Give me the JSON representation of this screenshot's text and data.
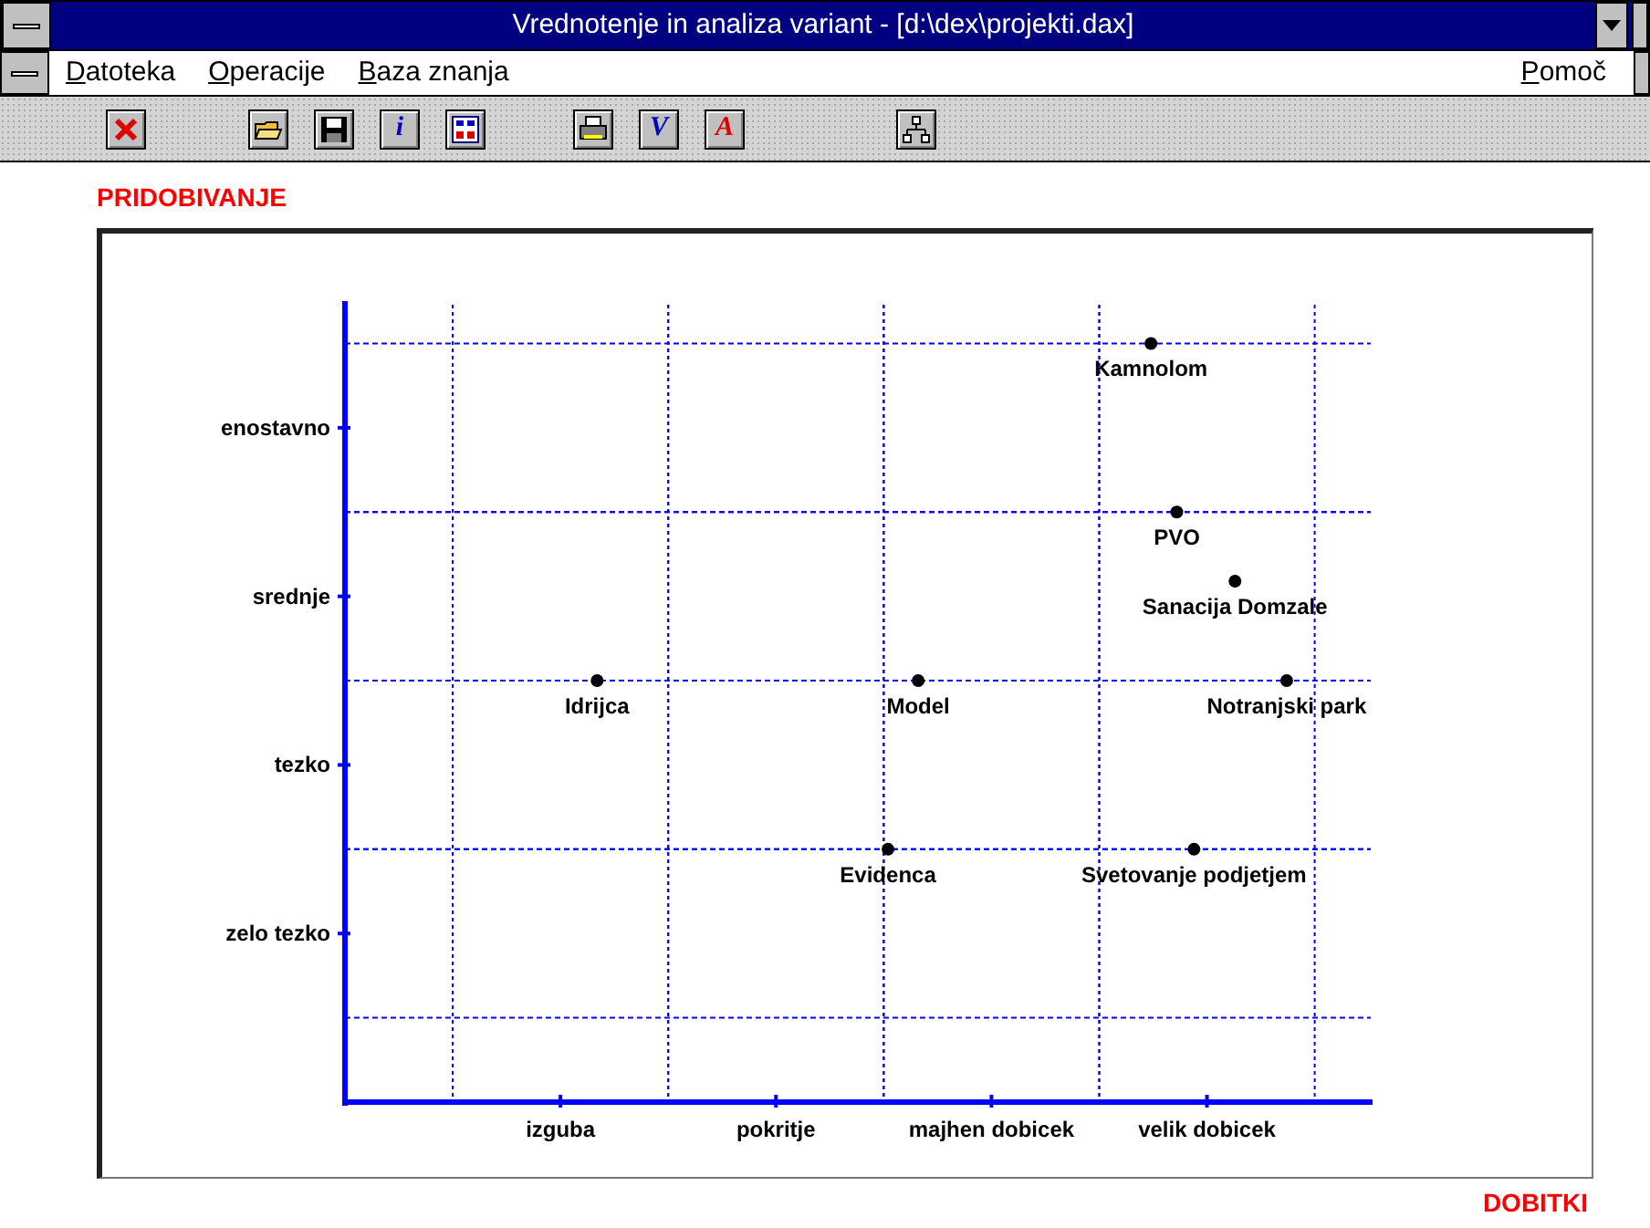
{
  "window": {
    "title": "Vrednotenje in analiza variant - [d:\\dex\\projekti.dax]"
  },
  "menu": {
    "items": [
      {
        "label": "Datoteka"
      },
      {
        "label": "Operacije"
      },
      {
        "label": "Baza znanja"
      }
    ],
    "help": {
      "label": "Pomoč"
    }
  },
  "toolbar": {
    "groups": [
      [
        {
          "kind": "close"
        }
      ],
      [
        {
          "kind": "open"
        },
        {
          "kind": "save"
        },
        {
          "kind": "letter",
          "label": "i",
          "color": "#0000c0"
        },
        {
          "kind": "grid"
        }
      ],
      [
        {
          "kind": "print"
        },
        {
          "kind": "letter",
          "label": "V",
          "color": "#0000c0"
        },
        {
          "kind": "letter",
          "label": "A",
          "color": "#e00000"
        }
      ],
      [
        {
          "kind": "tree"
        }
      ]
    ]
  },
  "chart": {
    "x_title": "DOBITKI",
    "y_title": "PRIDOBIVANJE",
    "x_labels": [
      "izguba",
      "pokritje",
      "majhen dobicek",
      "velik dobicek"
    ],
    "y_labels": [
      "enostavno",
      "srednje",
      "tezko",
      "zelo tezko"
    ],
    "points": [
      {
        "label": "Kamnolom"
      },
      {
        "label": "PVO"
      },
      {
        "label": "Sanacija Domzale"
      },
      {
        "label": "Idrijca"
      },
      {
        "label": "Model"
      },
      {
        "label": "Notranjski park"
      },
      {
        "label": "Evidenca"
      },
      {
        "label": "Svetovanje podjetjem"
      }
    ]
  }
}
